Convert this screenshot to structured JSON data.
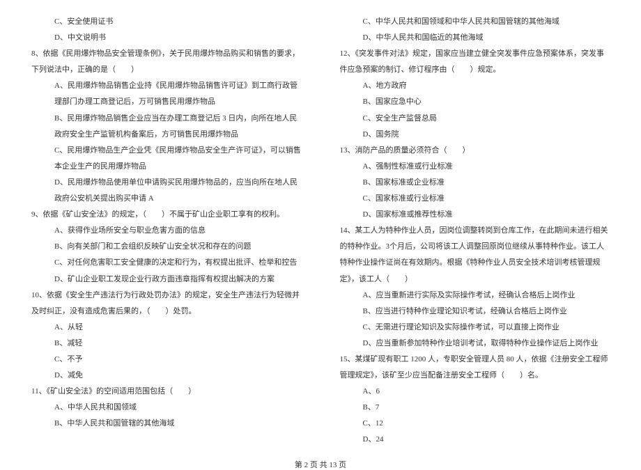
{
  "left": {
    "q7c": "C、安全使用证书",
    "q7d": "D、中文说明书",
    "q8": "8、依据《民用爆炸物品安全管理条例》，关于民用爆炸物品购买和销售的要求，下列说法中，正确的是（　　）",
    "q8a": "A、民用爆炸物品销售企业持《民用爆炸物品销售许可证》到工商行政管理部门办理工商登记后，万可销售民用爆炸物品",
    "q8b": "B、民用爆炸物品销售企业应当在办理工商登记后 3 日内，向所在地人民政府安全生产监管机构备案后，方可销售民用爆炸物品",
    "q8c": "C、民用爆炸物品生产企业凭《民用爆炸物品安全生产许可证》，可以销售本企业生产的民用爆炸物品",
    "q8d": "D、民用爆炸物品使用单位申请购买民用爆炸物品的，应当向所在地人民政府公安机关提出购买申请 A",
    "q9": "9、依据《矿山安全法》的规定，（　　）不属于矿山企业职工享有的权利。",
    "q9a": "A、获得作业场所安全与职业危害方面的信息",
    "q9b": "B、向有关部门和工会组织反映矿山安全状况和存在的问题",
    "q9c": "C、对任何危害职工安全健康的决定和行为，有权提出批评、检举和控告",
    "q9d": "D、矿山企业职工发现企业行政方面违章指挥有权提出解决的方案",
    "q10": "10、依据《安全生产违法行为行政处罚办法》的规定，安全生产违法行为轻微并及时纠正，没有造成危害后果的，（　　）处罚。",
    "q10a": "A、从轻",
    "q10b": "B、减轻",
    "q10c": "C、不予",
    "q10d": "D、减免",
    "q11": "11、《矿山安全法》的空间适用范围包括（　　）",
    "q11a": "A、中华人民共和国领域",
    "q11b": "B、中华人民共和国管辖的其他海域"
  },
  "right": {
    "q11c": "C、中华人民共和国领域和中华人民共和国管辖的其他海域",
    "q11d": "D、中华人民共和国临近的其他海域",
    "q12": "12、《突发事件对法》规定，国家应当建立健全突发事件应急预案体系，突发事件应急预案的制订、修订程序由（　　）规定。",
    "q12a": "A、地方政府",
    "q12b": "B、国家应急中心",
    "q12c": "C、安全生产监督总局",
    "q12d": "D、国务院",
    "q13": "13、消防产品的质量必须符合（　　）",
    "q13a": "A、强制性标准或行业标准",
    "q13b": "B、国家标准或企业标准",
    "q13c": "C、国家标准或行业标准",
    "q13d": "D、国家标准或推荐性标准",
    "q14": "14、某工人为特种作业人员，因岗位调整转岗到仓库工作，在此期间未进行相关的特种作业。3个月后，公司将该工人调整回原岗位继续从事特种作业。该工人特种作业操作证尚在有效期内。根据《特种作业人员安全技术培训考核管理规定》，该工人（　　）",
    "q14a": "A、应当重新进行实际及实际操作考试，经确认合格后上岗作业",
    "q14b": "B、应当进行特种作业理论知识考试，经确认合格后上岗作业",
    "q14c": "C、无需进行理论知识及实际操作考试，可以直接上岗作业",
    "q14d": "D、应当重新参加特种作业培训考试，取得特种作业操作证后上岗作业",
    "q15": "15、某煤矿现有职工 1200 人，专职安全管理人员 80 人，依据《注册安全工程师管理规定》，该矿至少应当配备注册安全工程师（　　）名。",
    "q15a": "A、6",
    "q15b": "B、7",
    "q15c": "C、12",
    "q15d": "D、24"
  },
  "footer": "第 2 页 共 13 页"
}
